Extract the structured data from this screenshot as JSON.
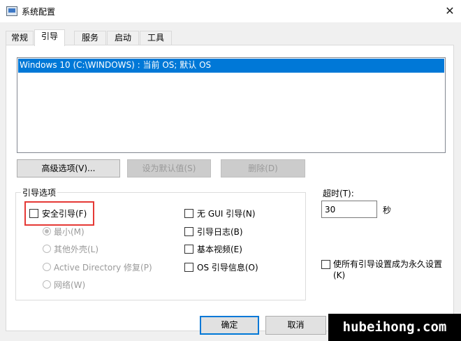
{
  "window": {
    "title": "系统配置",
    "close_glyph": "✕"
  },
  "tabs": [
    {
      "label": "常规"
    },
    {
      "label": "引导"
    },
    {
      "label": "服务"
    },
    {
      "label": "启动"
    },
    {
      "label": "工具"
    }
  ],
  "active_tab": "引导",
  "boot_list": {
    "entries": [
      "Windows 10 (C:\\WINDOWS) : 当前 OS; 默认 OS"
    ]
  },
  "buttons": {
    "advanced": "高级选项(V)...",
    "set_default": "设为默认值(S)",
    "delete": "删除(D)"
  },
  "boot_options": {
    "legend": "引导选项",
    "safe_boot": {
      "label": "安全引导(F)",
      "checked": false
    },
    "radios": [
      {
        "label": "最小(M)",
        "selected": true
      },
      {
        "label": "其他外壳(L)",
        "selected": false
      },
      {
        "label": "Active Directory 修复(P)",
        "selected": false
      },
      {
        "label": "网络(W)",
        "selected": false
      }
    ],
    "right_checks": [
      {
        "label": "无 GUI 引导(N)",
        "checked": false
      },
      {
        "label": "引导日志(B)",
        "checked": false
      },
      {
        "label": "基本视频(E)",
        "checked": false
      },
      {
        "label": "OS 引导信息(O)",
        "checked": false
      }
    ]
  },
  "timeout": {
    "label": "超时(T):",
    "value": "30",
    "unit": "秒"
  },
  "permanent": {
    "label": "使所有引导设置成为永久设置(K)",
    "checked": false
  },
  "footer": {
    "ok": "确定",
    "cancel": "取消"
  },
  "watermark": "hubeihong.com",
  "colors": {
    "selection": "#0078d7",
    "highlight_box": "#e53935"
  }
}
